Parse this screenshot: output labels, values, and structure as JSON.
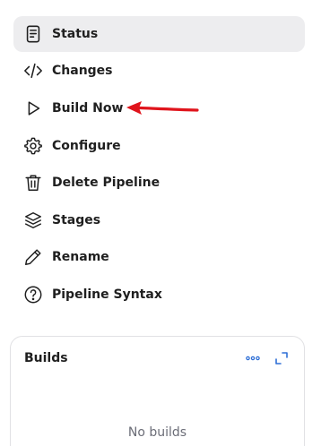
{
  "nav": {
    "items": [
      {
        "label": "Status",
        "icon": "status-icon",
        "active": true
      },
      {
        "label": "Changes",
        "icon": "code-icon"
      },
      {
        "label": "Build Now",
        "icon": "play-icon"
      },
      {
        "label": "Configure",
        "icon": "gear-icon"
      },
      {
        "label": "Delete Pipeline",
        "icon": "trash-icon"
      },
      {
        "label": "Stages",
        "icon": "layers-icon"
      },
      {
        "label": "Rename",
        "icon": "pencil-icon"
      },
      {
        "label": "Pipeline Syntax",
        "icon": "help-circle-icon"
      }
    ]
  },
  "annotation": {
    "color": "#e0141c",
    "icon": "red-arrow-icon"
  },
  "builds": {
    "title": "Builds",
    "empty_text": "No builds",
    "more_icon": "more-horizontal-icon",
    "expand_icon": "expand-icon"
  },
  "colors": {
    "active_bg": "#ededef",
    "link_blue": "#2f6fd6",
    "muted_text": "#6b6d77"
  }
}
